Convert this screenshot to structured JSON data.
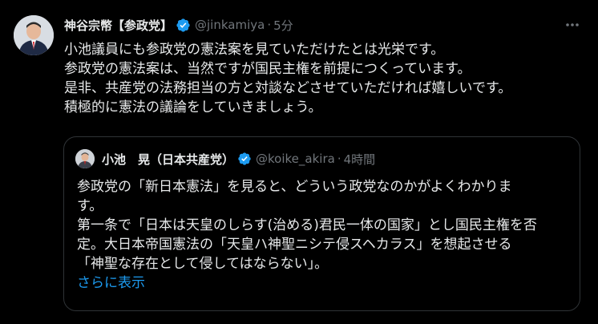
{
  "tweet": {
    "author_name": "神谷宗幣【参政党】",
    "handle": "@jinkamiya",
    "separator": "·",
    "time": "5分",
    "body_lines": [
      "小池議員にも参政党の憲法案を見ていただけたとは光栄です。",
      "参政党の憲法案は、当然ですが国民主権を前提につくっています。",
      "是非、共産党の法務担当の方と対談などさせていただければ嬉しいです。",
      "積極的に憲法の議論をしていきましょう。"
    ]
  },
  "quote": {
    "author_name": "小池　晃（日本共産党）",
    "handle": "@koike_akira",
    "separator": "·",
    "time": "4時間",
    "body_lines": [
      "参政党の「新日本憲法」を見ると、どういう政党なのかがよくわかりま",
      "す。",
      "第一条で「日本は天皇のしらす(治める)君民一体の国家」とし国民主権を否",
      "定。大日本帝国憲法の「天皇ハ神聖ニシテ侵スヘカラス」を想起させる",
      "「神聖な存在として侵してはならない」。"
    ],
    "show_more": "さらに表示"
  },
  "icons": {
    "verified": "verified-badge-icon",
    "more": "more-horizontal-icon"
  },
  "colors": {
    "background": "#000000",
    "text": "#e7e9ea",
    "secondary": "#71767b",
    "accent": "#1d9bf0",
    "border": "#2f3336"
  }
}
